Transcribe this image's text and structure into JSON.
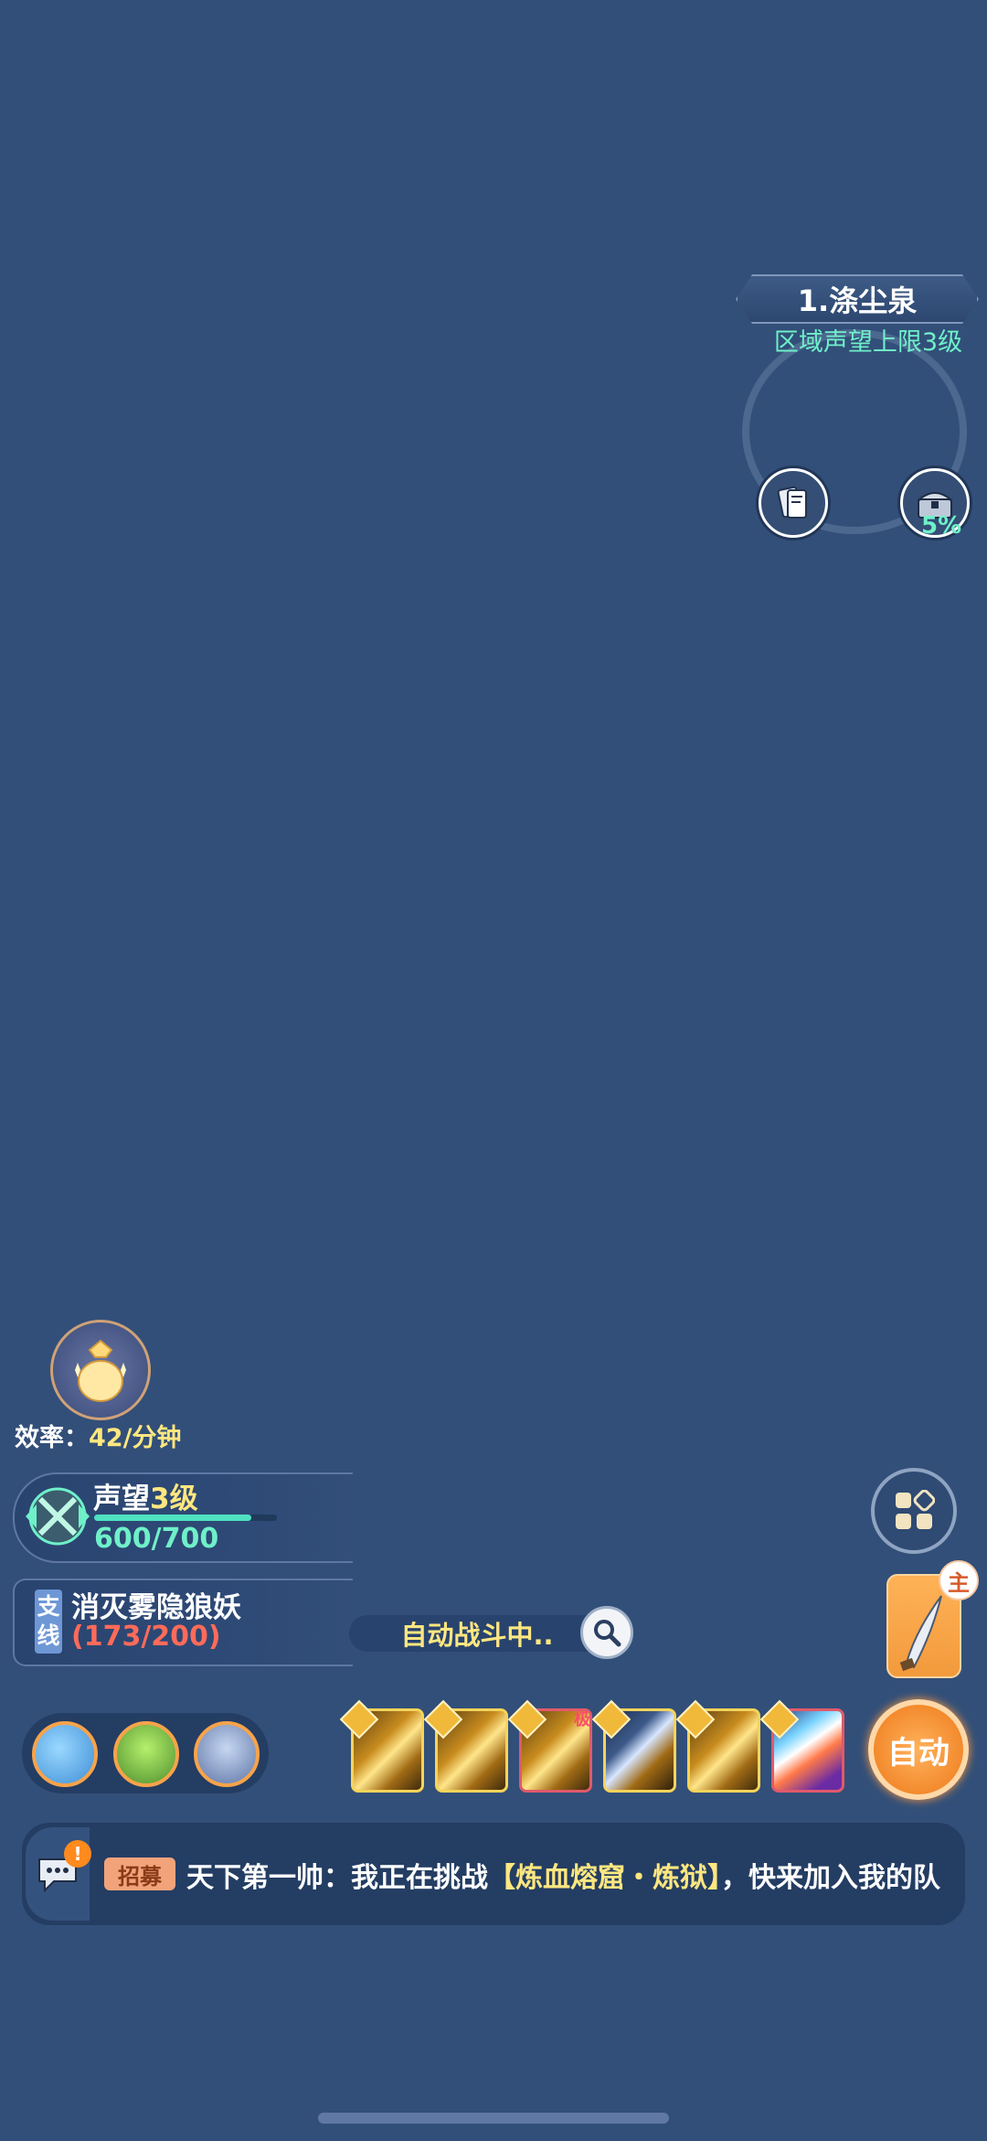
{
  "zone": {
    "title": "1.涤尘泉",
    "subtitle": "区域声望上限3级",
    "chest_percent": "5%"
  },
  "efficiency": {
    "label": "效率：",
    "value": "42/分钟"
  },
  "reputation": {
    "label": "声望",
    "level": "3级",
    "progress": "600/700",
    "fill_fraction": 0.86
  },
  "quest": {
    "tag": "支\n线",
    "title": "消灭雾隐狼妖",
    "progress": "(173/200)"
  },
  "auto_battle": {
    "status": "自动战斗中.."
  },
  "weapon": {
    "badge": "主"
  },
  "skills": {
    "tag": "极"
  },
  "auto_button": {
    "label": "自动"
  },
  "chat": {
    "tag": "招募",
    "alert": "!",
    "sender": "天下第一帅：我正在挑战",
    "highlight": "【炼血熔窟・炼狱】",
    "tail": "，快来加入我的队"
  },
  "icons": {
    "cards": "cards-icon",
    "chest": "chest-icon",
    "bag": "lucky-bag-icon",
    "emblem": "crossed-swords-emblem-icon",
    "search": "magnifier-icon",
    "menu": "grid-menu-icon",
    "weapon": "saber-icon",
    "chat": "chat-bubble-icon"
  }
}
